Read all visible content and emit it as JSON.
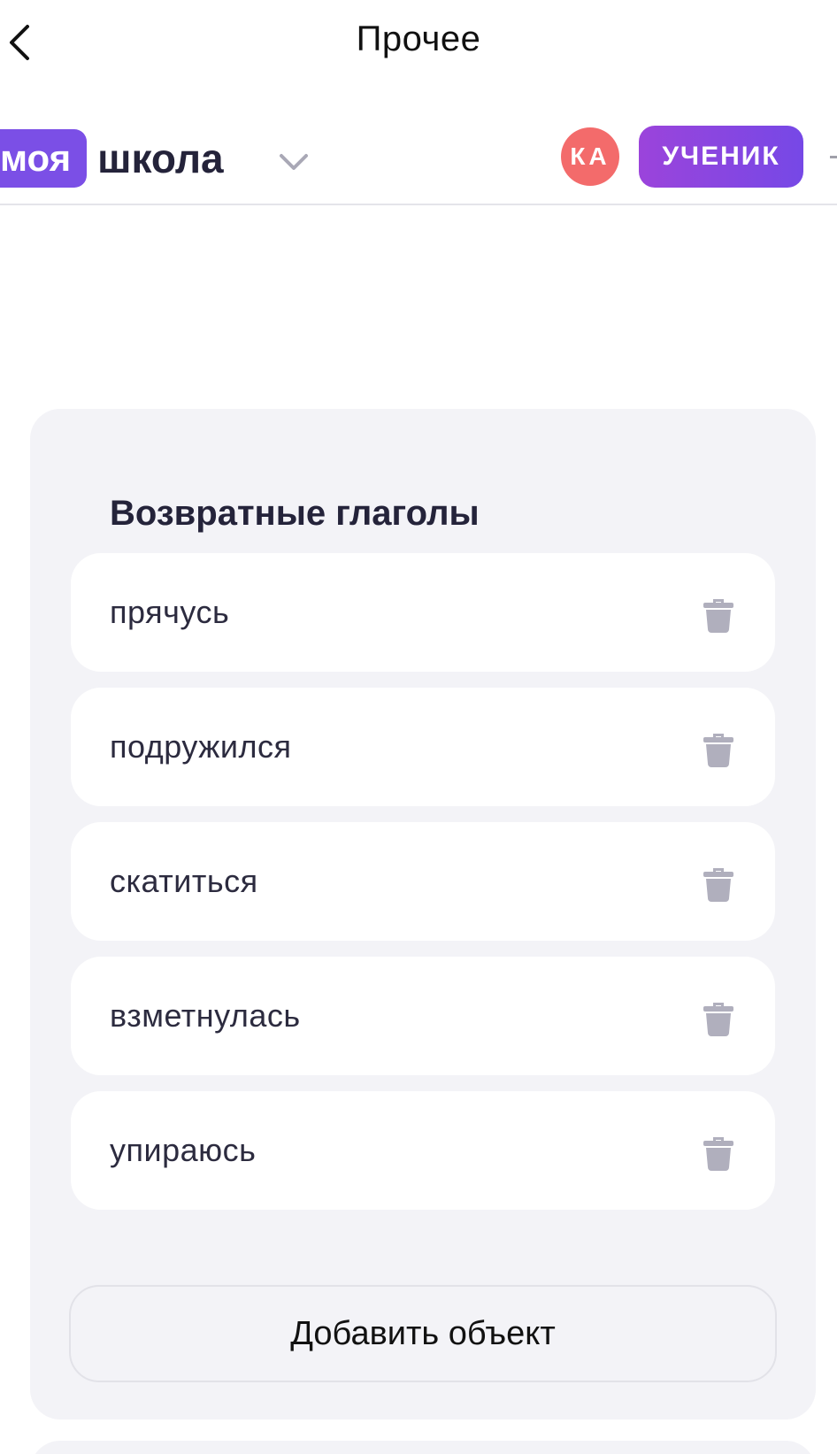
{
  "header": {
    "title": "Прочее"
  },
  "school": {
    "logo_badge": "моя",
    "logo_word": "школа",
    "avatar_initials": "КА",
    "role": "УЧЕНИК"
  },
  "card": {
    "title": "Возвратные глаголы",
    "items": [
      {
        "label": "прячусь"
      },
      {
        "label": "подружился"
      },
      {
        "label": "скатиться"
      },
      {
        "label": "взметнулась"
      },
      {
        "label": "упираюсь"
      }
    ],
    "add_label": "Добавить объект"
  },
  "colors": {
    "brand_purple": "#7b4fe6",
    "avatar_red": "#f36b6b",
    "card_bg": "#f3f3f7",
    "trash_gray": "#b0afbd"
  },
  "icons": {
    "back": "chevron-left-icon",
    "dropdown": "chevron-down-icon",
    "delete": "trash-icon"
  }
}
